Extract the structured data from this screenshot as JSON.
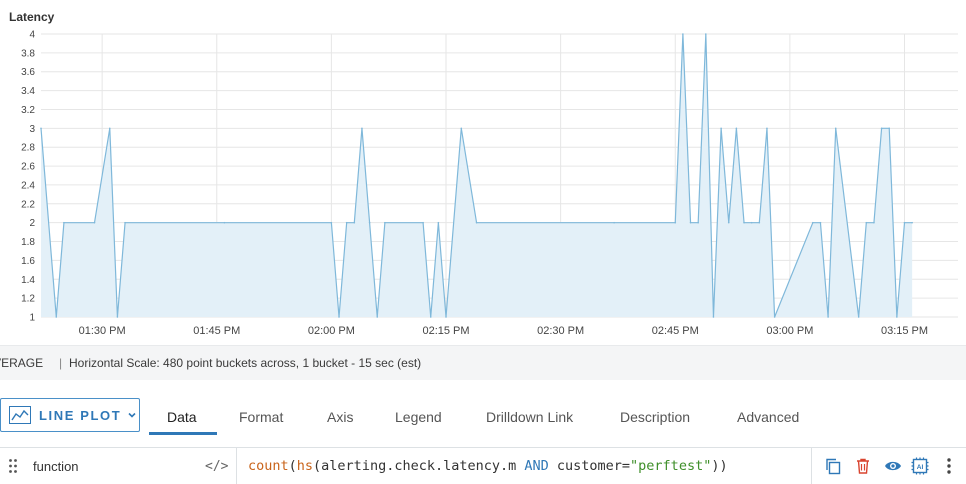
{
  "chart": {
    "title": "Latency",
    "colors": {
      "line": "#7fb8da",
      "fill": "#e3f0f8",
      "grid": "#e6e6e6",
      "spikeFill": "#bcd9ee"
    }
  },
  "chart_data": {
    "type": "area",
    "title": "Latency",
    "xlabel": "",
    "ylabel": "",
    "ylim": [
      1,
      4
    ],
    "yticks": [
      "1",
      "1.2",
      "1.4",
      "1.6",
      "1.8",
      "2",
      "2.2",
      "2.4",
      "2.6",
      "2.8",
      "3",
      "3.2",
      "3.4",
      "3.6",
      "3.8",
      "4"
    ],
    "xticks": [
      "01:30 PM",
      "01:45 PM",
      "02:00 PM",
      "02:15 PM",
      "02:30 PM",
      "02:45 PM",
      "03:00 PM",
      "03:15 PM"
    ],
    "grid": true,
    "series": [
      {
        "x": [
          "13:22",
          "13:24",
          "13:25",
          "13:29",
          "13:31",
          "13:32",
          "13:33",
          "13:46",
          "14:00",
          "14:01",
          "14:02",
          "14:03",
          "14:04",
          "14:05",
          "14:06",
          "14:07",
          "14:12",
          "14:13",
          "14:14",
          "14:15",
          "14:17",
          "14:19",
          "14:37",
          "14:45",
          "14:46",
          "14:47",
          "14:48",
          "14:49",
          "14:50",
          "14:51",
          "14:52",
          "14:53",
          "14:54",
          "14:55",
          "14:56",
          "14:57",
          "14:58",
          "15:03",
          "15:04",
          "15:05",
          "15:06",
          "15:09",
          "15:10",
          "15:11",
          "15:12",
          "15:13",
          "15:14",
          "15:15",
          "15:16"
        ],
        "values": [
          3,
          1,
          2,
          2,
          3,
          1,
          2,
          2,
          2,
          1,
          2,
          2,
          3,
          2,
          1,
          2,
          2,
          1,
          2,
          1,
          3,
          2,
          2,
          2,
          4,
          2,
          2,
          4,
          1,
          3,
          2,
          3,
          2,
          2,
          2,
          3,
          1,
          2,
          2,
          1,
          3,
          1,
          2,
          2,
          3,
          3,
          1,
          2,
          2
        ]
      }
    ]
  },
  "summary": {
    "aggregation": "AVERAGE",
    "separator": "|",
    "scale": "Horizontal Scale: 480 point buckets across, 1 bucket - 15 sec (est)"
  },
  "editor": {
    "plot_type": "LINE PLOT",
    "tabs": [
      "Data",
      "Format",
      "Axis",
      "Legend",
      "Drilldown Link",
      "Description",
      "Advanced"
    ],
    "active_tab": "Data"
  },
  "query": {
    "type": "function",
    "code_toggle": "</>",
    "fn_count": "count",
    "paren_open": "(",
    "fn_hs": "hs",
    "metric": "(alerting.check.latency.m ",
    "op_and": "AND",
    "key": " customer=",
    "value": "\"perftest\"",
    "close": "))",
    "icons": [
      "copy-icon",
      "delete-icon",
      "eye-icon",
      "ai-icon",
      "more-vertical-icon"
    ]
  }
}
